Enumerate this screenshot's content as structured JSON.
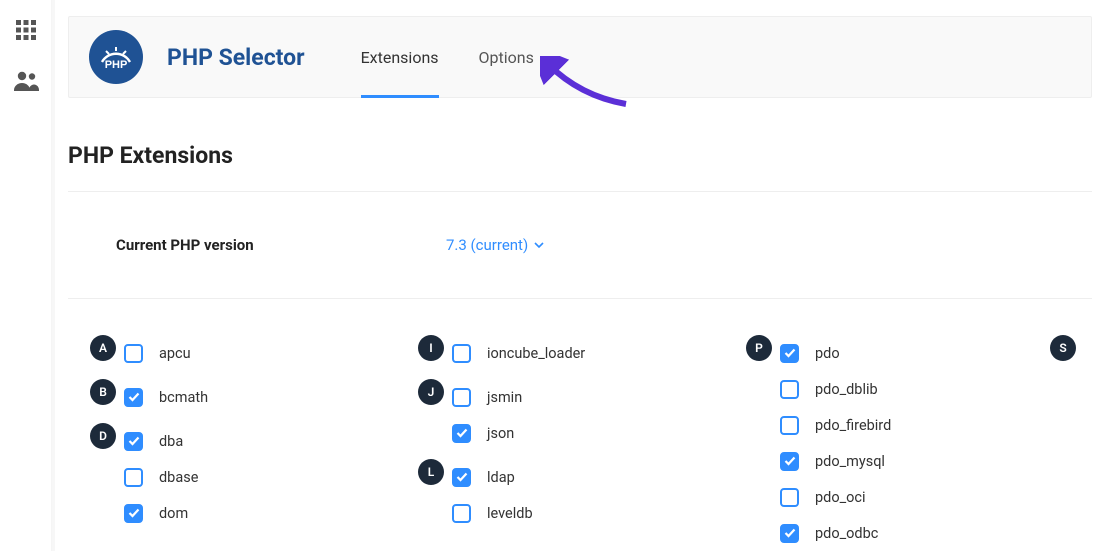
{
  "header": {
    "title": "PHP Selector",
    "tabs": [
      {
        "label": "Extensions",
        "active": true
      },
      {
        "label": "Options",
        "active": false
      }
    ]
  },
  "section_title": "PHP Extensions",
  "version": {
    "label": "Current PHP version",
    "value": "7.3 (current)"
  },
  "columns": [
    {
      "groups": [
        {
          "letter": "A",
          "items": [
            {
              "name": "apcu",
              "checked": false
            }
          ]
        },
        {
          "letter": "B",
          "items": [
            {
              "name": "bcmath",
              "checked": true
            }
          ]
        },
        {
          "letter": "D",
          "items": [
            {
              "name": "dba",
              "checked": true
            },
            {
              "name": "dbase",
              "checked": false
            },
            {
              "name": "dom",
              "checked": true
            }
          ]
        }
      ]
    },
    {
      "groups": [
        {
          "letter": "I",
          "items": [
            {
              "name": "ioncube_loader",
              "checked": false
            }
          ]
        },
        {
          "letter": "J",
          "items": [
            {
              "name": "jsmin",
              "checked": false
            },
            {
              "name": "json",
              "checked": true
            }
          ]
        },
        {
          "letter": "L",
          "items": [
            {
              "name": "ldap",
              "checked": true
            },
            {
              "name": "leveldb",
              "checked": false
            }
          ]
        }
      ]
    },
    {
      "groups": [
        {
          "letter": "P",
          "items": [
            {
              "name": "pdo",
              "checked": true
            },
            {
              "name": "pdo_dblib",
              "checked": false
            },
            {
              "name": "pdo_firebird",
              "checked": false
            },
            {
              "name": "pdo_mysql",
              "checked": true
            },
            {
              "name": "pdo_oci",
              "checked": false
            },
            {
              "name": "pdo_odbc",
              "checked": true
            }
          ]
        }
      ]
    },
    {
      "groups": [
        {
          "letter": "S",
          "items": []
        }
      ]
    }
  ]
}
